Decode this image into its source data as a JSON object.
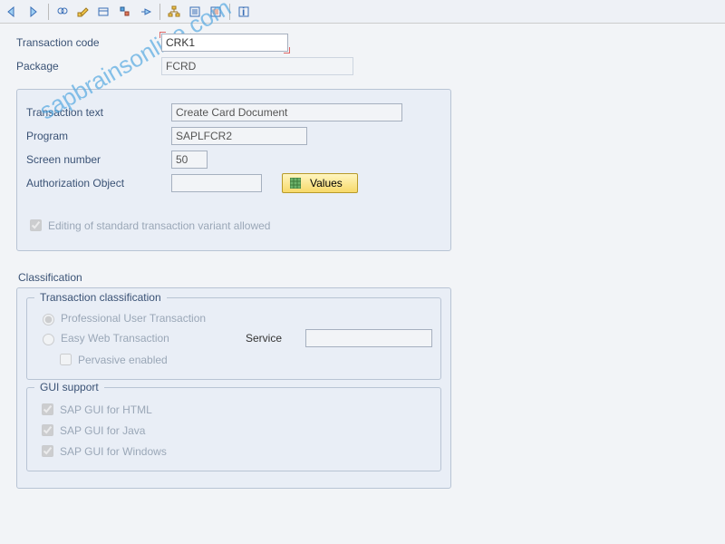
{
  "toolbar": {
    "icons": [
      "back",
      "forward",
      "sep",
      "display",
      "glasses",
      "pencil",
      "activate",
      "other",
      "sep",
      "hierarchy",
      "collapse",
      "expand",
      "sep",
      "info"
    ]
  },
  "header": {
    "transaction_code_label": "Transaction code",
    "transaction_code_value": "CRK1",
    "package_label": "Package",
    "package_value": "FCRD"
  },
  "details": {
    "transaction_text_label": "Transaction text",
    "transaction_text_value": "Create Card Document",
    "program_label": "Program",
    "program_value": "SAPLFCR2",
    "screen_number_label": "Screen number",
    "screen_number_value": "50",
    "auth_object_label": "Authorization Object",
    "auth_object_value": "",
    "values_button": "Values",
    "editing_allowed_label": "Editing of standard transaction variant allowed",
    "editing_allowed_checked": true
  },
  "classification": {
    "title": "Classification",
    "trans_class_title": "Transaction classification",
    "professional_label": "Professional User Transaction",
    "easy_web_label": "Easy Web Transaction",
    "service_label": "Service",
    "service_value": "",
    "pervasive_label": "Pervasive enabled",
    "gui_title": "GUI support",
    "gui_html_label": "SAP GUI for HTML",
    "gui_java_label": "SAP GUI for Java",
    "gui_windows_label": "SAP GUI for Windows"
  },
  "watermark": "sapbrainsonline.com"
}
